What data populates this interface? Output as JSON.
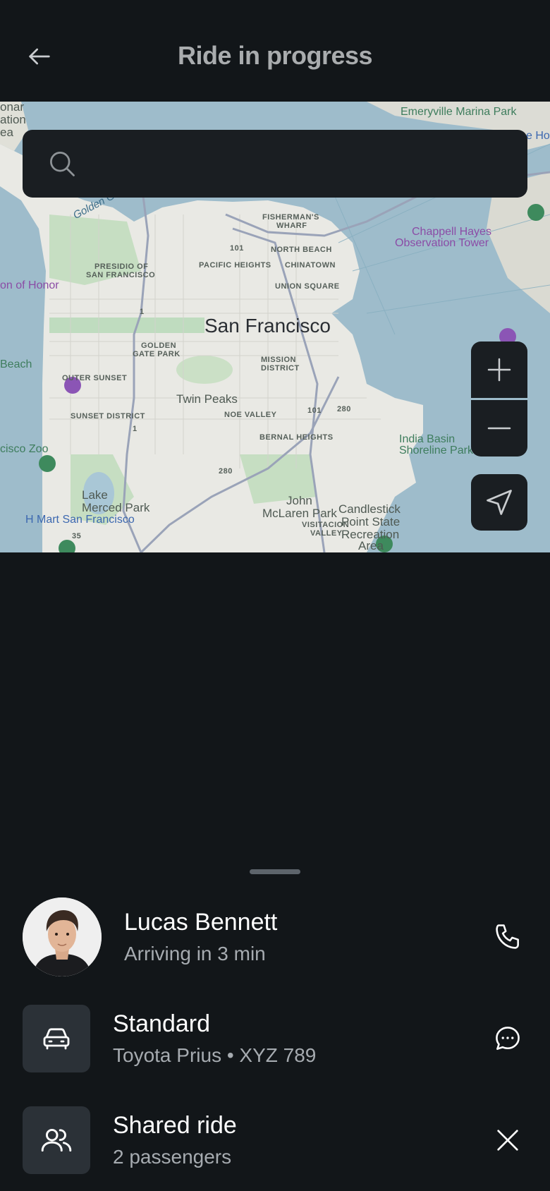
{
  "header": {
    "title": "Ride in progress",
    "back_icon": "arrow-left-icon"
  },
  "search": {
    "placeholder": "",
    "value": "",
    "icon": "search-icon"
  },
  "map": {
    "labels": {
      "city": "San Francisco",
      "emeryville": "Emeryville Marina Park",
      "fishermans1": "FISHERMAN'S",
      "fishermans2": "WHARF",
      "north_beach": "NORTH BEACH",
      "pacific_heights": "PACIFIC HEIGHTS",
      "chinatown": "CHINATOWN",
      "union_square": "UNION SQUARE",
      "presidio1": "PRESIDIO OF",
      "presidio2": "SAN FRANCISCO",
      "golden_gate_park1": "GOLDEN",
      "golden_gate_park2": "GATE PARK",
      "mission1": "MISSION",
      "mission2": "DISTRICT",
      "outer_sunset": "OUTER SUNSET",
      "sunset_district": "SUNSET DISTRICT",
      "twin_peaks": "Twin Peaks",
      "noe_valley": "NOE VALLEY",
      "bernal_heights": "BERNAL HEIGHTS",
      "india_basin1": "India Basin",
      "india_basin2": "Shoreline Park",
      "chappell1": "Chappell Hayes",
      "chappell2": "Observation Tower",
      "legion": "on of Honor",
      "beach": "Beach",
      "zoo": "cisco Zoo",
      "lake_merced1": "Lake",
      "lake_merced2": "Merced Park",
      "hmart": "H Mart San Francisco",
      "john_mclaren1": "John",
      "john_mclaren2": "McLaren Park",
      "visitacion1": "VISITACION",
      "visitacion2": "VALLEY",
      "candlestick1": "Candlestick",
      "candlestick2": "Point State",
      "candlestick3": "Recreation",
      "candlestick4": "Area",
      "golden_gate": "Golden Gate",
      "ation": "ation",
      "ea": "ea",
      "onar": "onar",
      "e_ho": "e Ho",
      "hwy_101": "101",
      "hwy_1": "1",
      "hwy_280": "280",
      "hwy_35": "35"
    },
    "controls": {
      "zoom_in_icon": "plus-icon",
      "zoom_out_icon": "minus-icon",
      "locate_icon": "navigation-arrow-icon"
    }
  },
  "driver": {
    "name": "Lucas Bennett",
    "status": "Arriving in 3 min",
    "call_icon": "phone-icon"
  },
  "vehicle": {
    "title": "Standard",
    "subtitle": "Toyota Prius • XYZ 789",
    "icon": "car-icon",
    "message_icon": "chat-icon"
  },
  "ride": {
    "title": "Shared ride",
    "subtitle": "2 passengers",
    "icon": "users-icon",
    "cancel_icon": "close-icon"
  },
  "colors": {
    "background": "#121619",
    "card": "#1a1e22",
    "icon_box": "#2b3137",
    "text_primary": "#ffffff",
    "text_secondary": "#a6abb0"
  }
}
